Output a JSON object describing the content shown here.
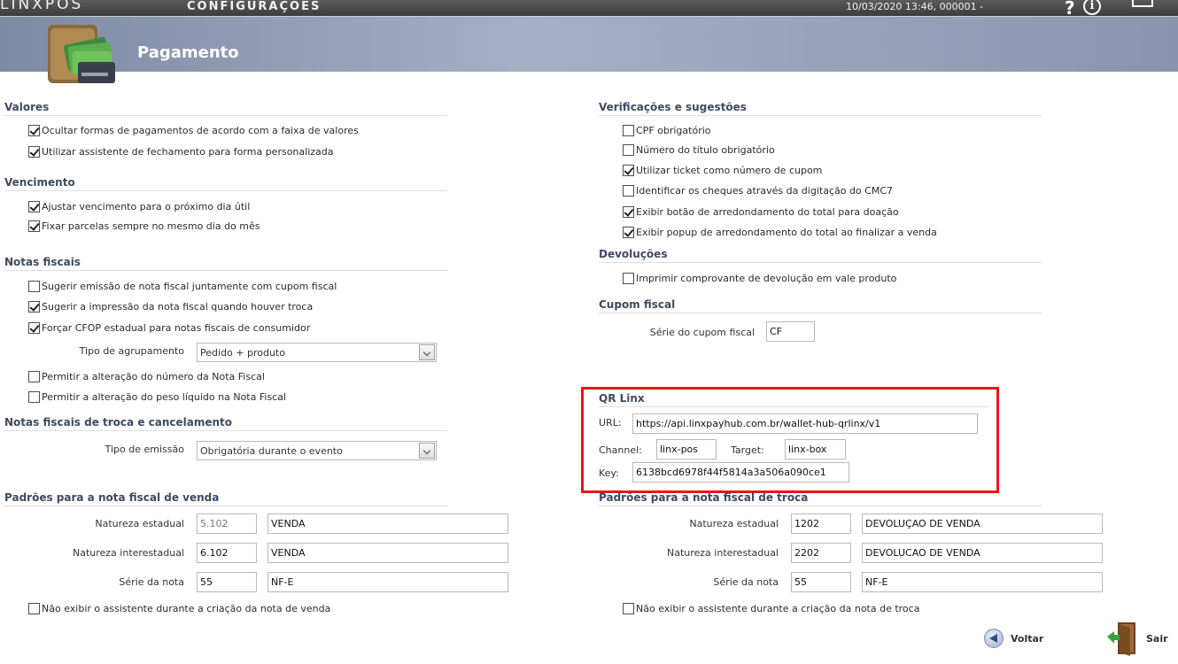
{
  "topbar": {
    "brand": "LINXPOS",
    "screen_title": "CONFIGURAÇÕES",
    "datetime": "10/03/2020 13:46, 000001 -",
    "help_glyph": "?",
    "info_glyph": "i"
  },
  "header": {
    "title": "Pagamento",
    "icon": "wallet-icon"
  },
  "left": {
    "valores": {
      "title": "Valores",
      "items": [
        {
          "label": "Ocultar formas de pagamentos de acordo com a faixa de valores",
          "checked": true
        },
        {
          "label": "Utilizar assistente de fechamento para forma personalizada",
          "checked": true
        }
      ]
    },
    "vencimento": {
      "title": "Vencimento",
      "items": [
        {
          "label": "Ajustar vencimento para o próximo dia útil",
          "checked": true
        },
        {
          "label": "Fixar parcelas sempre no mesmo dia do mês",
          "checked": true
        }
      ]
    },
    "notas_fiscais": {
      "title": "Notas fiscais",
      "items": [
        {
          "label": "Sugerir emissão de nota fiscal juntamente com cupom fiscal",
          "checked": false
        },
        {
          "label": "Sugerir a impressão da nota fiscal quando houver troca",
          "checked": true
        },
        {
          "label": "Forçar CFOP estadual para notas fiscais de consumidor",
          "checked": true
        }
      ],
      "agrupamento_label": "Tipo de agrupamento",
      "agrupamento_value": "Pedido + produto",
      "items2": [
        {
          "label": "Permitir a alteração do número da Nota Fiscal",
          "checked": false
        },
        {
          "label": "Permitir a alteração do peso líquido na Nota Fiscal",
          "checked": false
        }
      ]
    },
    "troca_cancelamento": {
      "title": "Notas fiscais de troca e cancelamento",
      "emissao_label": "Tipo de emissão",
      "emissao_value": "Obrigatória durante o evento"
    },
    "padroes_venda": {
      "title": "Padrões para a nota fiscal de venda",
      "rows": [
        {
          "label": "Natureza estadual",
          "code": "5.102",
          "desc": "VENDA"
        },
        {
          "label": "Natureza interestadual",
          "code": "6.102",
          "desc": "VENDA"
        },
        {
          "label": "Série da nota",
          "code": "55",
          "desc": "NF-E"
        }
      ],
      "checkbox": {
        "label": "Não exibir o assistente durante a criação da nota de venda",
        "checked": false
      }
    }
  },
  "right": {
    "verificacoes": {
      "title": "Verificações e sugestões",
      "items": [
        {
          "label": "CPF obrigatório",
          "checked": false
        },
        {
          "label": "Número do título obrigatório",
          "checked": false
        },
        {
          "label": "Utilizar ticket como número de cupom",
          "checked": true
        },
        {
          "label": "Identificar os cheques através da digitação do CMC7",
          "checked": false
        },
        {
          "label": "Exibir botão de arredondamento do total para doação",
          "checked": true
        },
        {
          "label": "Exibir popup de arredondamento do total ao finalizar a venda",
          "checked": true
        }
      ]
    },
    "devolucoes": {
      "title": "Devoluções",
      "items": [
        {
          "label": "Imprimir comprovante de devolução em vale produto",
          "checked": false
        }
      ]
    },
    "cupom_fiscal": {
      "title": "Cupom fiscal",
      "serie_label": "Série do cupom fiscal",
      "serie_value": "CF"
    },
    "qr_linx": {
      "title": "QR Linx",
      "url_label": "URL:",
      "url_value": "https://api.linxpayhub.com.br/wallet-hub-qrlinx/v1",
      "channel_label": "Channel:",
      "channel_value": "linx-pos",
      "target_label": "Target:",
      "target_value": "linx-box",
      "key_label": "Key:",
      "key_value": "6138bcd6978f44f5814a3a506a090ce1"
    },
    "padroes_troca": {
      "title": "Padrões para a nota fiscal de troca",
      "rows": [
        {
          "label": "Natureza estadual",
          "code": "1202",
          "desc": "DEVOLUÇAO DE VENDA"
        },
        {
          "label": "Natureza interestadual",
          "code": "2202",
          "desc": "DEVOLUCAO DE VENDA"
        },
        {
          "label": "Série da nota",
          "code": "55",
          "desc": "NF-E"
        }
      ],
      "checkbox": {
        "label": "Não exibir o assistente durante a criação da nota de troca",
        "checked": false
      }
    }
  },
  "footer": {
    "back_label": "Voltar",
    "exit_label": "Sair"
  },
  "colors": {
    "accent": "#3f4a60",
    "highlight_border": "#e8151b",
    "header": "#a5b0c6"
  }
}
